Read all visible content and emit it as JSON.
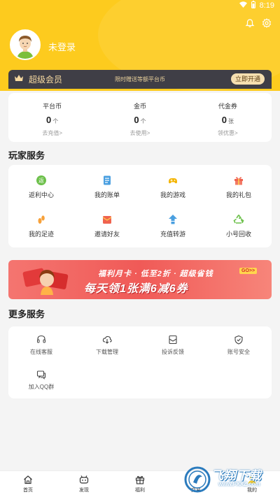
{
  "status_bar": {
    "time": "8:19"
  },
  "header": {
    "login_text": "未登录",
    "icons": [
      "bell-icon",
      "gear-icon"
    ],
    "color": "#fdcb1e"
  },
  "vip": {
    "title": "超级会员",
    "promo": "限时赠送等额平台币",
    "button": "立即开通"
  },
  "stats": [
    {
      "title": "平台币",
      "value": "0",
      "unit": "个",
      "link": "去充值>"
    },
    {
      "title": "金币",
      "value": "0",
      "unit": "个",
      "link": "去使用>"
    },
    {
      "title": "代金券",
      "value": "0",
      "unit": "张",
      "link": "领优惠>"
    }
  ],
  "player_services": {
    "title": "玩家服务",
    "items": [
      {
        "label": "返利中心",
        "icon": "rebate-icon"
      },
      {
        "label": "我的账单",
        "icon": "bill-icon"
      },
      {
        "label": "我的游戏",
        "icon": "gamepad-icon"
      },
      {
        "label": "我的礼包",
        "icon": "gift-icon"
      },
      {
        "label": "我的足迹",
        "icon": "footprint-icon"
      },
      {
        "label": "邀请好友",
        "icon": "invite-envelope-icon"
      },
      {
        "label": "充值转游",
        "icon": "transfer-icon"
      },
      {
        "label": "小号回收",
        "icon": "recycle-icon"
      }
    ]
  },
  "banner": {
    "line1": "福利月卡 · 低至2折 · 超级省钱",
    "line2": "每天领1张满6减6券",
    "tag": "GO>>"
  },
  "more_services": {
    "title": "更多服务",
    "items": [
      {
        "label": "在线客服",
        "icon": "headset-icon"
      },
      {
        "label": "下载管理",
        "icon": "download-cloud-icon"
      },
      {
        "label": "投诉反馈",
        "icon": "feedback-icon"
      },
      {
        "label": "账号安全",
        "icon": "shield-icon"
      },
      {
        "label": "加入QQ群",
        "icon": "chat-group-icon"
      }
    ]
  },
  "tabbar": [
    {
      "label": "首页",
      "icon": "home-icon"
    },
    {
      "label": "发现",
      "icon": "discover-icon"
    },
    {
      "label": "福利",
      "icon": "gift-box-icon"
    },
    {
      "label": "交易",
      "icon": "trade-icon"
    },
    {
      "label": "我的",
      "icon": "user-icon"
    }
  ],
  "watermark": {
    "text": "飞翔下载",
    "url": "www.FXXZ.com"
  }
}
